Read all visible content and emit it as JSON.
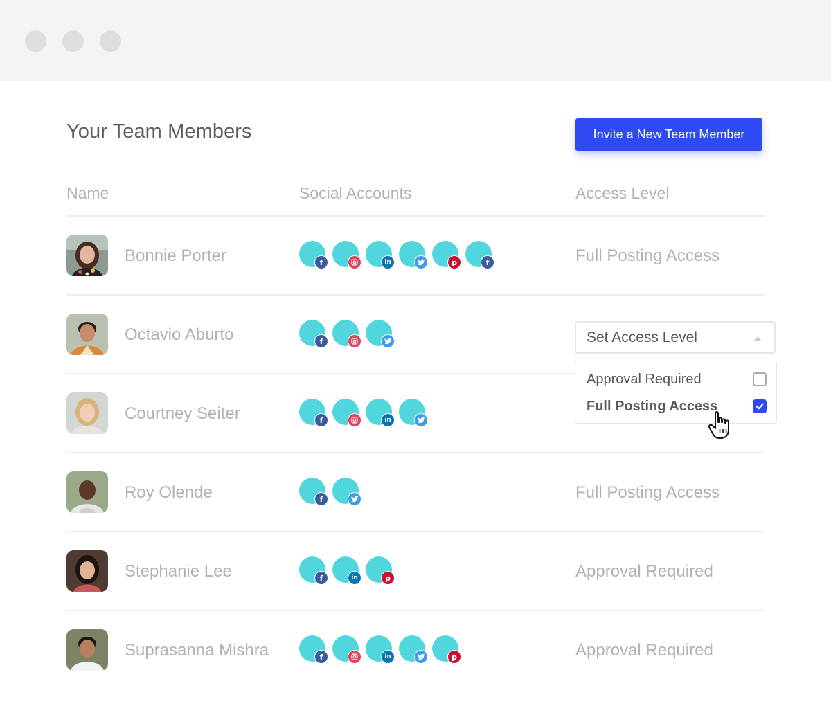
{
  "window": {
    "controls": [
      "close-dot",
      "minimize-dot",
      "maximize-dot"
    ]
  },
  "header": {
    "title": "Your Team Members",
    "invite_label": "Invite a New Team Member"
  },
  "columns": {
    "name": "Name",
    "social": "Social Accounts",
    "access": "Access Level"
  },
  "members": [
    {
      "name": "Bonnie Porter",
      "access": "Full Posting Access",
      "socials": [
        "facebook",
        "instagram",
        "linkedin",
        "twitter",
        "pinterest",
        "facebook"
      ]
    },
    {
      "name": "Octavio Aburto",
      "access": "",
      "socials": [
        "facebook",
        "instagram",
        "twitter"
      ]
    },
    {
      "name": "Courtney Seiter",
      "access": "",
      "socials": [
        "facebook",
        "instagram",
        "linkedin",
        "twitter"
      ]
    },
    {
      "name": "Roy Olende",
      "access": "Full Posting Access",
      "socials": [
        "facebook",
        "twitter"
      ]
    },
    {
      "name": "Stephanie Lee",
      "access": "Approval Required",
      "socials": [
        "facebook",
        "linkedin",
        "pinterest"
      ]
    },
    {
      "name": "Suprasanna Mishra",
      "access": "Approval Required",
      "socials": [
        "facebook",
        "instagram",
        "linkedin",
        "twitter",
        "pinterest"
      ]
    }
  ],
  "access_dropdown": {
    "label": "Set Access Level",
    "options": [
      {
        "label": "Approval Required",
        "checked": false
      },
      {
        "label": "Full Posting Access",
        "checked": true
      }
    ]
  },
  "colors": {
    "accent": "#2e4bf3",
    "social_circle": "#52d6de",
    "facebook": "#3b5aa0",
    "instagram": "#e0435f",
    "linkedin": "#0a74b0",
    "twitter": "#3d9be9",
    "pinterest": "#c8102e"
  }
}
